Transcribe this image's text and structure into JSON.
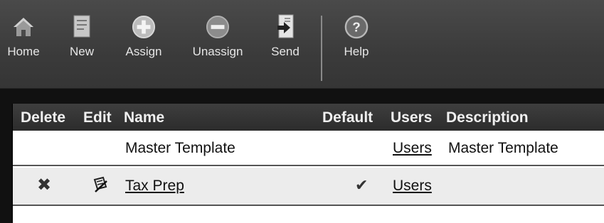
{
  "toolbar": {
    "buttons": [
      {
        "label": "Home",
        "icon": "home-icon"
      },
      {
        "label": "New",
        "icon": "new-document-icon"
      },
      {
        "label": "Assign",
        "icon": "plus-circle-icon"
      },
      {
        "label": "Unassign",
        "icon": "minus-circle-icon"
      },
      {
        "label": "Send",
        "icon": "send-document-icon"
      },
      {
        "label": "Help",
        "icon": "help-question-icon"
      }
    ]
  },
  "table": {
    "columns": [
      "Delete",
      "Edit",
      "Name",
      "Default",
      "Users",
      "Description"
    ],
    "rows": [
      {
        "name": "Master Template",
        "default": "",
        "users": "Users",
        "description": "Master Template",
        "deletable": false
      },
      {
        "name": "Tax Prep",
        "default": "✔",
        "users": "Users",
        "description": "",
        "deletable": true,
        "delete_icon": "✖"
      }
    ]
  },
  "colors": {
    "toolbar_bg": "#3b3b3b",
    "header_bg": "#2c2c2c",
    "row_alt": "#ececec"
  }
}
